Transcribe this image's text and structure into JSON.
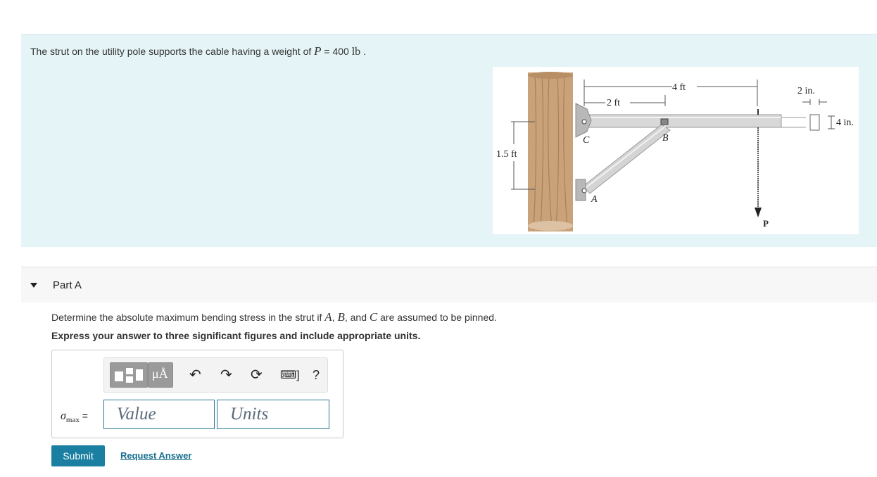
{
  "problem": {
    "text_before": "The strut on the utility pole supports the cable having a weight of ",
    "var": "P",
    "eq": " = 400 ",
    "unit": "lb",
    "end": " ."
  },
  "figure": {
    "dim_4ft": "4 ft",
    "dim_2ft": "2 ft",
    "dim_15ft": "1.5 ft",
    "dim_2in": "2 in.",
    "dim_4in": "4 in.",
    "label_c": "C",
    "label_b": "B",
    "label_a": "A",
    "label_p": "P"
  },
  "part": {
    "title": "Part A"
  },
  "question": {
    "t1": "Determine the absolute maximum bending stress in the strut if ",
    "a": "A",
    "c1": ", ",
    "b": "B",
    "t2": ", and ",
    "c": "C",
    "t3": " are assumed to be pinned."
  },
  "instruction": "Express your answer to three significant figures and include appropriate units.",
  "answer": {
    "symbol": "σ",
    "subscript": "max",
    "equals": "=",
    "value_placeholder": "Value",
    "units_placeholder": "Units",
    "mu_label": "μÅ",
    "help_label": "?"
  },
  "buttons": {
    "submit": "Submit",
    "request": "Request Answer"
  }
}
